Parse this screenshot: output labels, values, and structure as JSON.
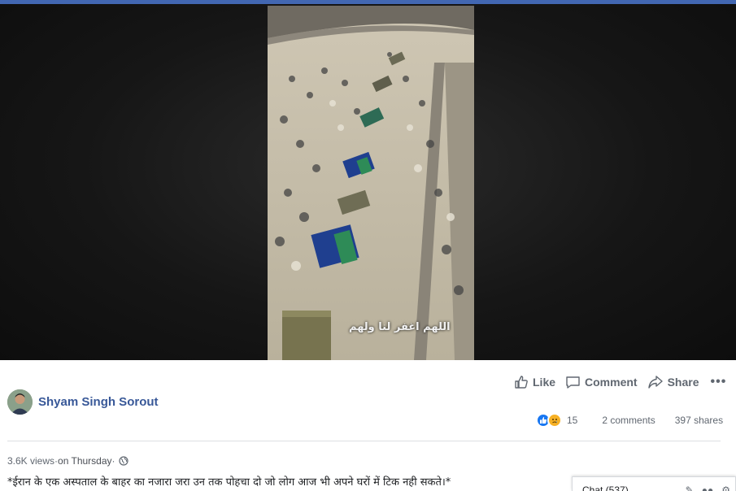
{
  "video": {
    "caption": "اللهم اغفر لنا ولهم"
  },
  "author": {
    "name": "Shyam Singh Sorout"
  },
  "actions": {
    "like": "Like",
    "comment": "Comment",
    "share": "Share",
    "more": "•••"
  },
  "stats": {
    "reaction_count": "15",
    "comments": "2 comments",
    "shares": "397 shares"
  },
  "meta": {
    "views": "3.6K views",
    "separator": " · ",
    "date": "on Thursday"
  },
  "post": {
    "text": "*ईरान के एक अस्पताल के बाहर का नजारा जरा उन तक पोहचा दो जो लोग आज भी अपने घरों में टिक नही सकते।*"
  },
  "chat": {
    "label": "Chat (537)"
  },
  "colors": {
    "brand": "#4267b2",
    "link": "#385898",
    "like_blue": "#1877f2",
    "sad_yellow": "#f7b125"
  }
}
